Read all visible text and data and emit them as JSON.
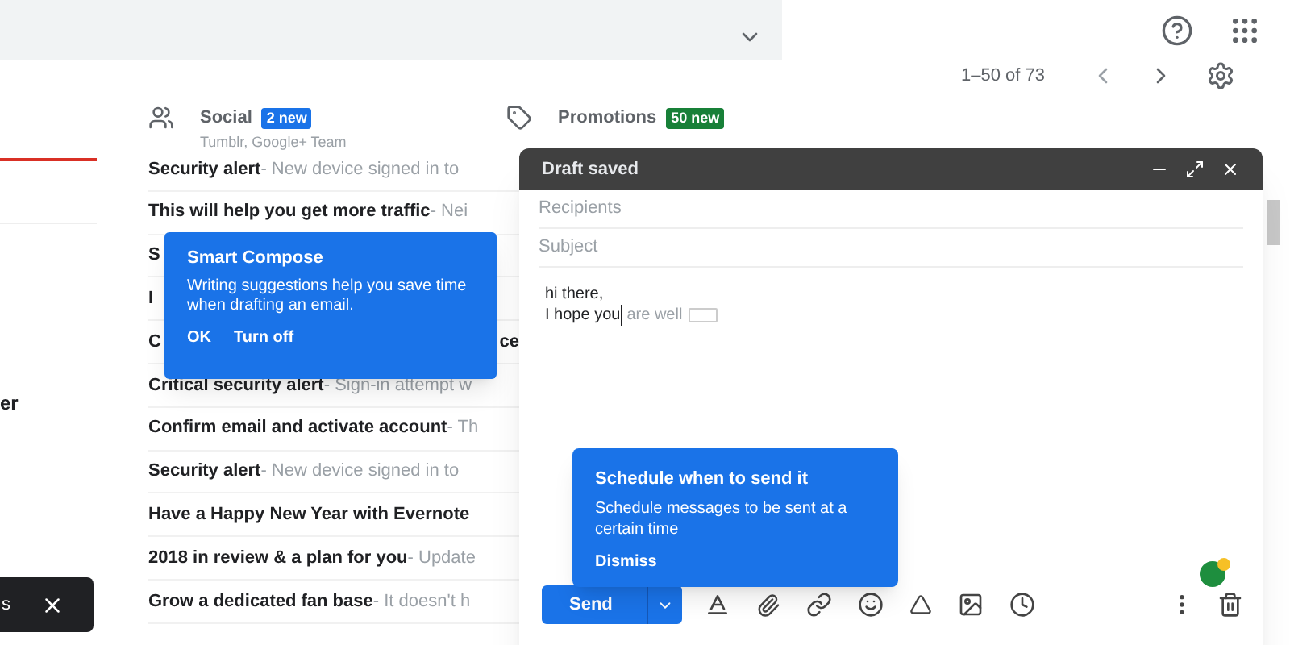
{
  "toolbar": {
    "range": "1–50 of 73"
  },
  "tabs": [
    {
      "label": "Social",
      "badge": "2 new",
      "color": "#1a73e8",
      "subtitle": "Tumblr, Google+ Team",
      "kind": "people"
    },
    {
      "label": "Promotions",
      "badge": "50 new",
      "color": "#188038",
      "kind": "tag"
    }
  ],
  "sidebar": {
    "label": "er"
  },
  "snackbar": {
    "text": "s"
  },
  "emails": [
    {
      "subject": "Security alert",
      "snippet": " - New device signed in to"
    },
    {
      "subject": "This will help you get more traffic",
      "snippet": " - Nei"
    },
    {
      "subject": "S"
    },
    {
      "subject": "I"
    },
    {
      "subject": "C",
      "tail": "ce"
    },
    {
      "subject": "Critical security alert",
      "snippet": " - Sign-in attempt w"
    },
    {
      "subject": "Confirm email and activate account",
      "snippet": " - Th"
    },
    {
      "subject": "Security alert",
      "snippet": " - New device signed in to"
    },
    {
      "subject": "Have a Happy New Year with Evernote"
    },
    {
      "subject": "2018 in review & a plan for you",
      "snippet": " - Update"
    },
    {
      "subject": "Grow a dedicated fan base",
      "snippet": " - It doesn't h"
    }
  ],
  "smart_compose": {
    "title": "Smart Compose",
    "body": "Writing suggestions help you save time when drafting an email.",
    "actions": [
      "OK",
      "Turn off"
    ]
  },
  "compose": {
    "title": "Draft saved",
    "recipients_placeholder": "Recipients",
    "subject_placeholder": "Subject",
    "greeting": "hi there,",
    "typed": "I hope you",
    "suggestion": "are well"
  },
  "schedule_tip": {
    "title": "Schedule when to send it",
    "body": "Schedule messages to be sent at a certain time",
    "action": "Dismiss"
  },
  "send": {
    "label": "Send"
  }
}
